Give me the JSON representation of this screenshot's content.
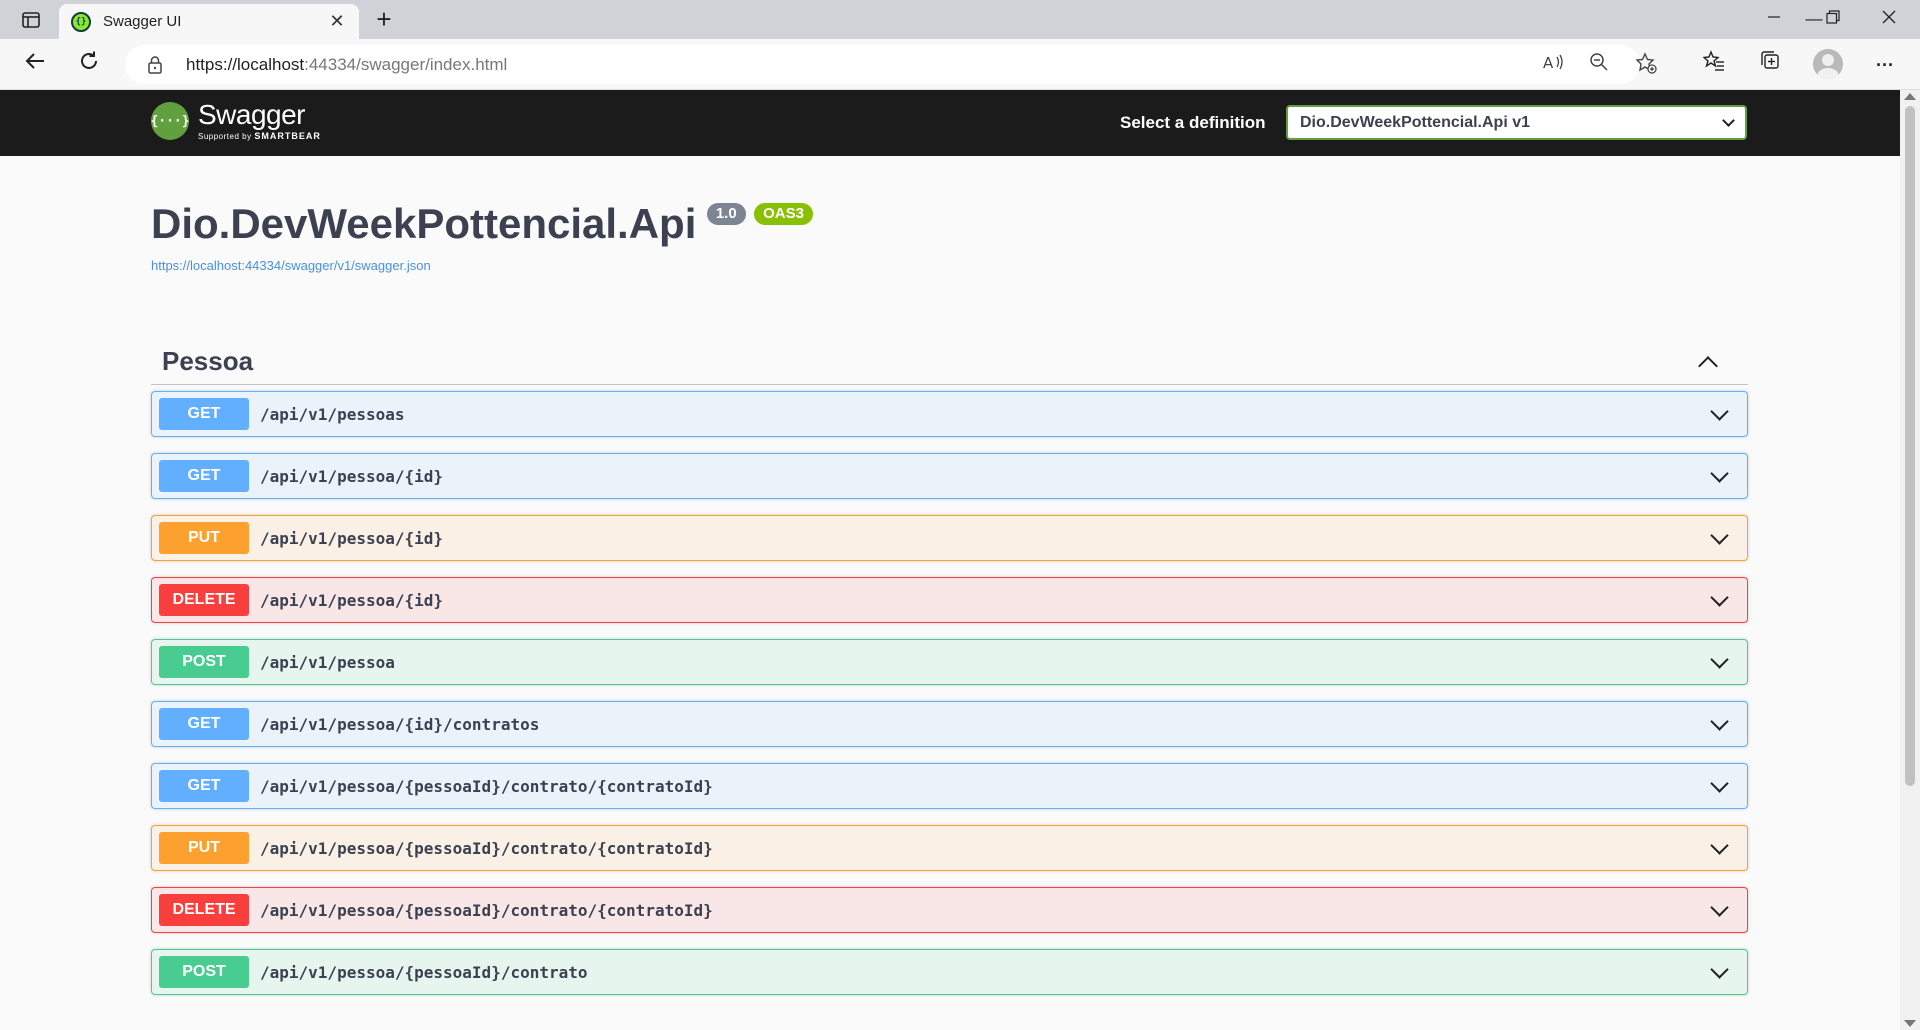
{
  "browser": {
    "tab_title": "Swagger UI",
    "tab_close": "✕",
    "new_tab": "+",
    "url_host": "https://localhost",
    "url_rest": ":44334/swagger/index.html",
    "window_controls": {
      "minimize": "—",
      "restore": "❐",
      "close": "✕"
    },
    "menu": "···"
  },
  "swagger": {
    "logo_name": "Swagger",
    "logo_sub_prefix": "Supported by",
    "logo_sub_brand": "SMARTBEAR",
    "logo_glyph": "{···}",
    "definition_label": "Select a definition",
    "definition_value": "Dio.DevWeekPottencial.Api v1",
    "api_title": "Dio.DevWeekPottencial.Api",
    "version_badge": "1.0",
    "oas_badge": "OAS3",
    "spec_url": "https://localhost:44334/swagger/v1/swagger.json",
    "tag_name": "Pessoa",
    "operations": [
      {
        "method": "GET",
        "path": "/api/v1/pessoas"
      },
      {
        "method": "GET",
        "path": "/api/v1/pessoa/{id}"
      },
      {
        "method": "PUT",
        "path": "/api/v1/pessoa/{id}"
      },
      {
        "method": "DELETE",
        "path": "/api/v1/pessoa/{id}"
      },
      {
        "method": "POST",
        "path": "/api/v1/pessoa"
      },
      {
        "method": "GET",
        "path": "/api/v1/pessoa/{id}/contratos"
      },
      {
        "method": "GET",
        "path": "/api/v1/pessoa/{pessoaId}/contrato/{contratoId}"
      },
      {
        "method": "PUT",
        "path": "/api/v1/pessoa/{pessoaId}/contrato/{contratoId}"
      },
      {
        "method": "DELETE",
        "path": "/api/v1/pessoa/{pessoaId}/contrato/{contratoId}"
      },
      {
        "method": "POST",
        "path": "/api/v1/pessoa/{pessoaId}/contrato"
      }
    ]
  },
  "colors": {
    "get": "#61affe",
    "put": "#fca130",
    "delete": "#f93e3e",
    "post": "#49cc90",
    "swagger_green": "#62a03f",
    "topbar": "#1b1b1b"
  }
}
